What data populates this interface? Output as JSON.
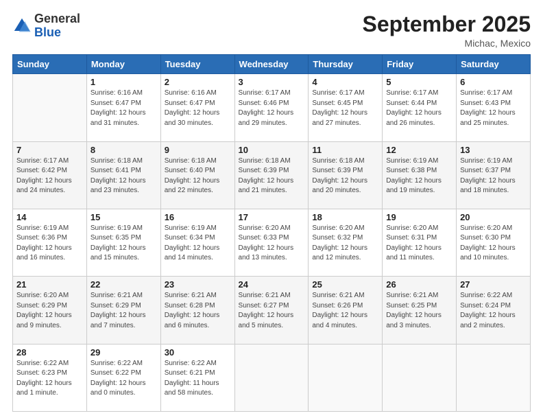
{
  "header": {
    "logo_general": "General",
    "logo_blue": "Blue",
    "month_title": "September 2025",
    "location": "Michac, Mexico"
  },
  "weekdays": [
    "Sunday",
    "Monday",
    "Tuesday",
    "Wednesday",
    "Thursday",
    "Friday",
    "Saturday"
  ],
  "weeks": [
    [
      {
        "day": "",
        "info": ""
      },
      {
        "day": "1",
        "info": "Sunrise: 6:16 AM\nSunset: 6:47 PM\nDaylight: 12 hours\nand 31 minutes."
      },
      {
        "day": "2",
        "info": "Sunrise: 6:16 AM\nSunset: 6:47 PM\nDaylight: 12 hours\nand 30 minutes."
      },
      {
        "day": "3",
        "info": "Sunrise: 6:17 AM\nSunset: 6:46 PM\nDaylight: 12 hours\nand 29 minutes."
      },
      {
        "day": "4",
        "info": "Sunrise: 6:17 AM\nSunset: 6:45 PM\nDaylight: 12 hours\nand 27 minutes."
      },
      {
        "day": "5",
        "info": "Sunrise: 6:17 AM\nSunset: 6:44 PM\nDaylight: 12 hours\nand 26 minutes."
      },
      {
        "day": "6",
        "info": "Sunrise: 6:17 AM\nSunset: 6:43 PM\nDaylight: 12 hours\nand 25 minutes."
      }
    ],
    [
      {
        "day": "7",
        "info": "Sunrise: 6:17 AM\nSunset: 6:42 PM\nDaylight: 12 hours\nand 24 minutes."
      },
      {
        "day": "8",
        "info": "Sunrise: 6:18 AM\nSunset: 6:41 PM\nDaylight: 12 hours\nand 23 minutes."
      },
      {
        "day": "9",
        "info": "Sunrise: 6:18 AM\nSunset: 6:40 PM\nDaylight: 12 hours\nand 22 minutes."
      },
      {
        "day": "10",
        "info": "Sunrise: 6:18 AM\nSunset: 6:39 PM\nDaylight: 12 hours\nand 21 minutes."
      },
      {
        "day": "11",
        "info": "Sunrise: 6:18 AM\nSunset: 6:39 PM\nDaylight: 12 hours\nand 20 minutes."
      },
      {
        "day": "12",
        "info": "Sunrise: 6:19 AM\nSunset: 6:38 PM\nDaylight: 12 hours\nand 19 minutes."
      },
      {
        "day": "13",
        "info": "Sunrise: 6:19 AM\nSunset: 6:37 PM\nDaylight: 12 hours\nand 18 minutes."
      }
    ],
    [
      {
        "day": "14",
        "info": "Sunrise: 6:19 AM\nSunset: 6:36 PM\nDaylight: 12 hours\nand 16 minutes."
      },
      {
        "day": "15",
        "info": "Sunrise: 6:19 AM\nSunset: 6:35 PM\nDaylight: 12 hours\nand 15 minutes."
      },
      {
        "day": "16",
        "info": "Sunrise: 6:19 AM\nSunset: 6:34 PM\nDaylight: 12 hours\nand 14 minutes."
      },
      {
        "day": "17",
        "info": "Sunrise: 6:20 AM\nSunset: 6:33 PM\nDaylight: 12 hours\nand 13 minutes."
      },
      {
        "day": "18",
        "info": "Sunrise: 6:20 AM\nSunset: 6:32 PM\nDaylight: 12 hours\nand 12 minutes."
      },
      {
        "day": "19",
        "info": "Sunrise: 6:20 AM\nSunset: 6:31 PM\nDaylight: 12 hours\nand 11 minutes."
      },
      {
        "day": "20",
        "info": "Sunrise: 6:20 AM\nSunset: 6:30 PM\nDaylight: 12 hours\nand 10 minutes."
      }
    ],
    [
      {
        "day": "21",
        "info": "Sunrise: 6:20 AM\nSunset: 6:29 PM\nDaylight: 12 hours\nand 9 minutes."
      },
      {
        "day": "22",
        "info": "Sunrise: 6:21 AM\nSunset: 6:29 PM\nDaylight: 12 hours\nand 7 minutes."
      },
      {
        "day": "23",
        "info": "Sunrise: 6:21 AM\nSunset: 6:28 PM\nDaylight: 12 hours\nand 6 minutes."
      },
      {
        "day": "24",
        "info": "Sunrise: 6:21 AM\nSunset: 6:27 PM\nDaylight: 12 hours\nand 5 minutes."
      },
      {
        "day": "25",
        "info": "Sunrise: 6:21 AM\nSunset: 6:26 PM\nDaylight: 12 hours\nand 4 minutes."
      },
      {
        "day": "26",
        "info": "Sunrise: 6:21 AM\nSunset: 6:25 PM\nDaylight: 12 hours\nand 3 minutes."
      },
      {
        "day": "27",
        "info": "Sunrise: 6:22 AM\nSunset: 6:24 PM\nDaylight: 12 hours\nand 2 minutes."
      }
    ],
    [
      {
        "day": "28",
        "info": "Sunrise: 6:22 AM\nSunset: 6:23 PM\nDaylight: 12 hours\nand 1 minute."
      },
      {
        "day": "29",
        "info": "Sunrise: 6:22 AM\nSunset: 6:22 PM\nDaylight: 12 hours\nand 0 minutes."
      },
      {
        "day": "30",
        "info": "Sunrise: 6:22 AM\nSunset: 6:21 PM\nDaylight: 11 hours\nand 58 minutes."
      },
      {
        "day": "",
        "info": ""
      },
      {
        "day": "",
        "info": ""
      },
      {
        "day": "",
        "info": ""
      },
      {
        "day": "",
        "info": ""
      }
    ]
  ]
}
